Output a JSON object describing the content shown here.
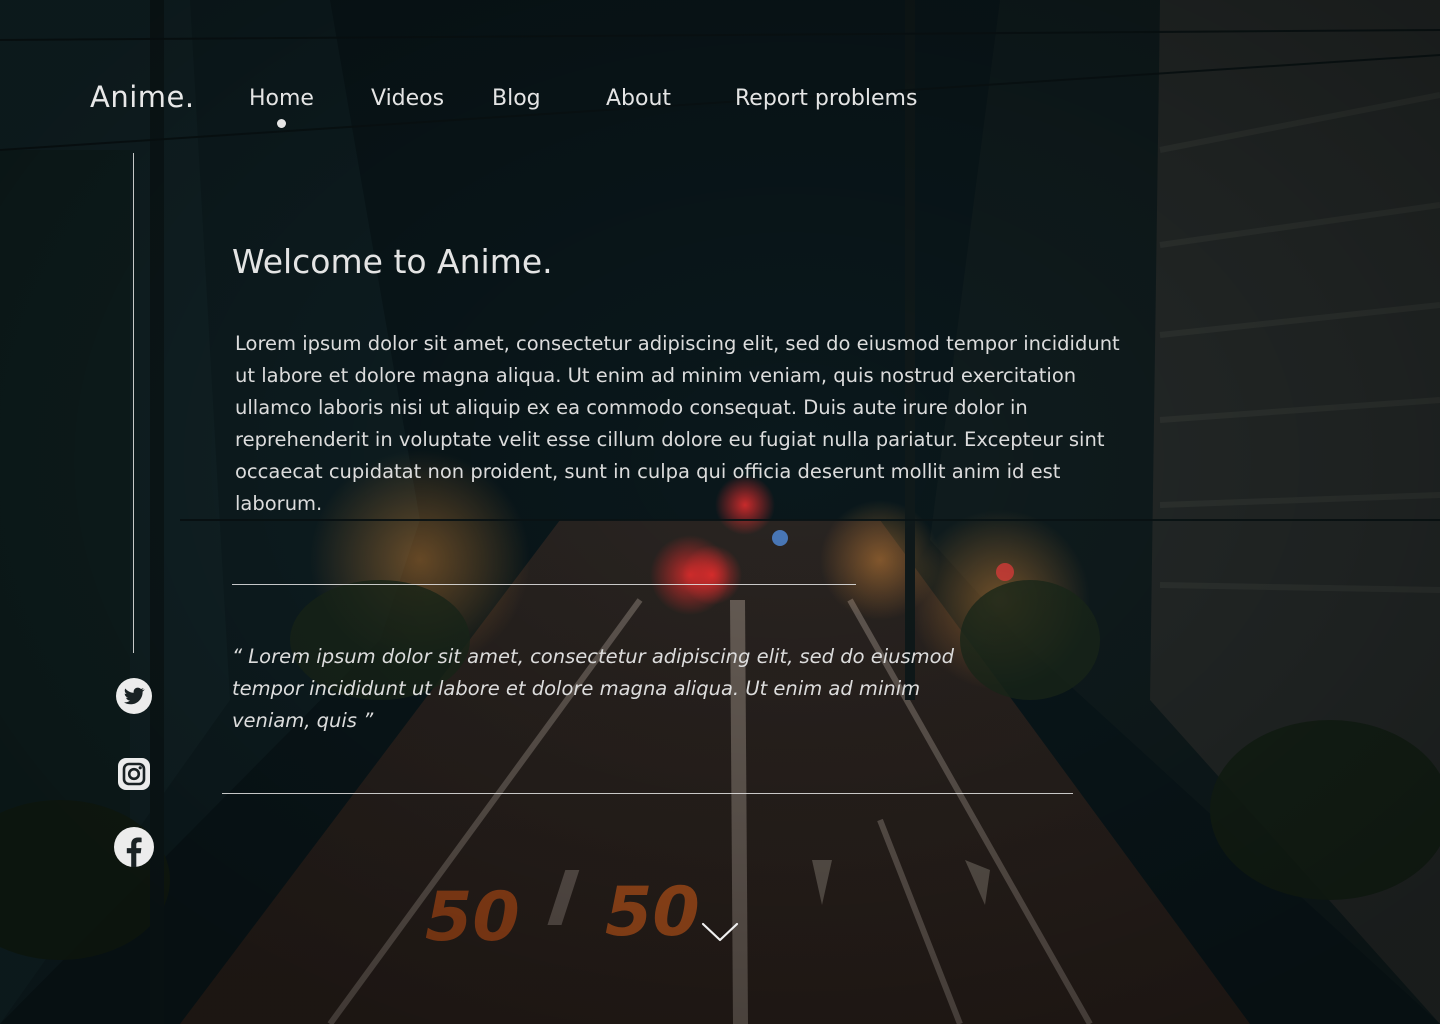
{
  "header": {
    "logo": "Anime.",
    "nav": {
      "home": "Home",
      "videos": "Videos",
      "blog": "Blog",
      "about": "About",
      "report": "Report problems"
    },
    "active_item": "Home"
  },
  "hero": {
    "title": "Welcome to Anime.",
    "body": "Lorem ipsum dolor sit amet, consectetur adipiscing elit, sed do eiusmod tempor incididunt ut labore et dolore magna aliqua. Ut enim ad minim veniam, quis nostrud exercitation ullamco laboris nisi ut aliquip ex ea commodo consequat. Duis aute irure dolor in reprehenderit in voluptate velit esse cillum dolore eu fugiat nulla pariatur. Excepteur sint occaecat cupidatat non proident, sunt in culpa qui officia deserunt mollit anim id est laborum.",
    "quote": "“ Lorem ipsum dolor sit amet, consectetur adipiscing elit, sed do eiusmod tempor incididunt ut labore et dolore magna aliqua. Ut enim ad minim veniam, quis ”"
  },
  "social": {
    "icons": [
      "twitter-icon",
      "instagram-icon",
      "facebook-icon"
    ]
  },
  "scroll": {
    "icon": "chevron-down-icon"
  },
  "background": {
    "road_marking": "50 / 50"
  },
  "colors": {
    "text": "#e4e4e4",
    "lines": "#e6e6e6",
    "background_dark": "#0b1618",
    "road_marking": "#d2691e"
  }
}
